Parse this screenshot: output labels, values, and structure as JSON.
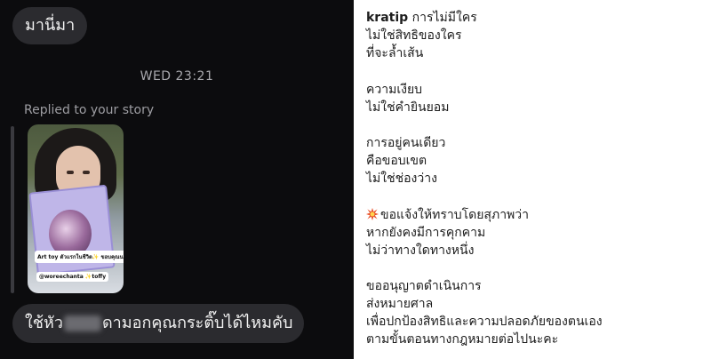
{
  "chat": {
    "top_message": "มานี่มา",
    "timestamp": "WED 23:21",
    "reply_note": "Replied to your story",
    "story_tag_1": "Art toy ตัวแรกในชีวิต✨ ขอบคุณนะคะ",
    "story_tag_2": "@woreechanta ✨toffy",
    "bottom_message_start": "ใช้หัว",
    "bottom_message_end": "ดามอกคุณกระติ๊บได้ไหมคับ"
  },
  "caption": {
    "username": "kratip",
    "first_line_rest": " การไม่มีใคร",
    "stanzas": [
      [
        "ไม่ใช่สิทธิของใคร",
        "ที่จะล้ำเส้น"
      ],
      [
        "ความเงียบ",
        "ไม่ใช่คำยินยอม"
      ],
      [
        "การอยู่คนเดียว",
        "คือขอบเขต",
        "ไม่ใช่ช่องว่าง"
      ],
      [
        "ขอแจ้งให้ทราบโดยสุภาพว่า",
        "หากยังคงมีการคุกคาม",
        "ไม่ว่าทางใดทางหนึ่ง"
      ],
      [
        "ขออนุญาตดำเนินการ",
        "ส่งหมายศาล",
        "เพื่อปกป้องสิทธิและความปลอดภัยของตนเอง",
        "ตามขั้นตอนทางกฎหมายต่อไปนะคะ"
      ]
    ]
  },
  "icons": {
    "burst": "collision-icon"
  },
  "colors": {
    "chat_bg": "#0c0c0e",
    "bubble_bg": "#2b2b2f",
    "caption_text": "#1d1d1d",
    "burst": "#e8512b"
  }
}
